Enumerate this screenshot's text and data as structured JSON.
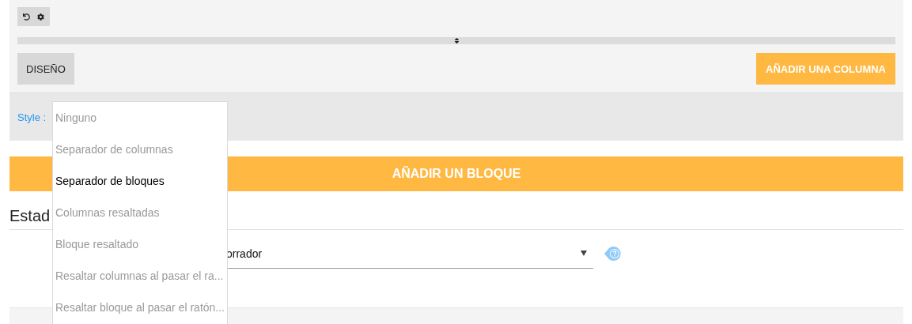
{
  "toolbar": {
    "buttons": [
      {
        "kind": "undo"
      },
      {
        "kind": "settings"
      }
    ]
  },
  "design_button": {
    "label": "DISEÑO"
  },
  "add_column_button": {
    "label": "AÑADIR UNA COLUMNA"
  },
  "style_row": {
    "label": "Style :"
  },
  "add_block_button": {
    "label": "AÑADIR UN BLOQUE"
  },
  "section": {
    "heading": "Estad"
  },
  "status_select": {
    "value": "orrador"
  },
  "style_menu": {
    "items": [
      {
        "label": "Ninguno",
        "selected": false
      },
      {
        "label": "Separador de columnas",
        "selected": false
      },
      {
        "label": "Separador de bloques",
        "selected": true
      },
      {
        "label": "Columnas resaltadas",
        "selected": false
      },
      {
        "label": "Bloque resaltado",
        "selected": false
      },
      {
        "label": "Resaltar columnas al pasar el ra...",
        "selected": false
      },
      {
        "label": "Resaltar bloque al pasar el ratón...",
        "selected": false
      }
    ]
  }
}
